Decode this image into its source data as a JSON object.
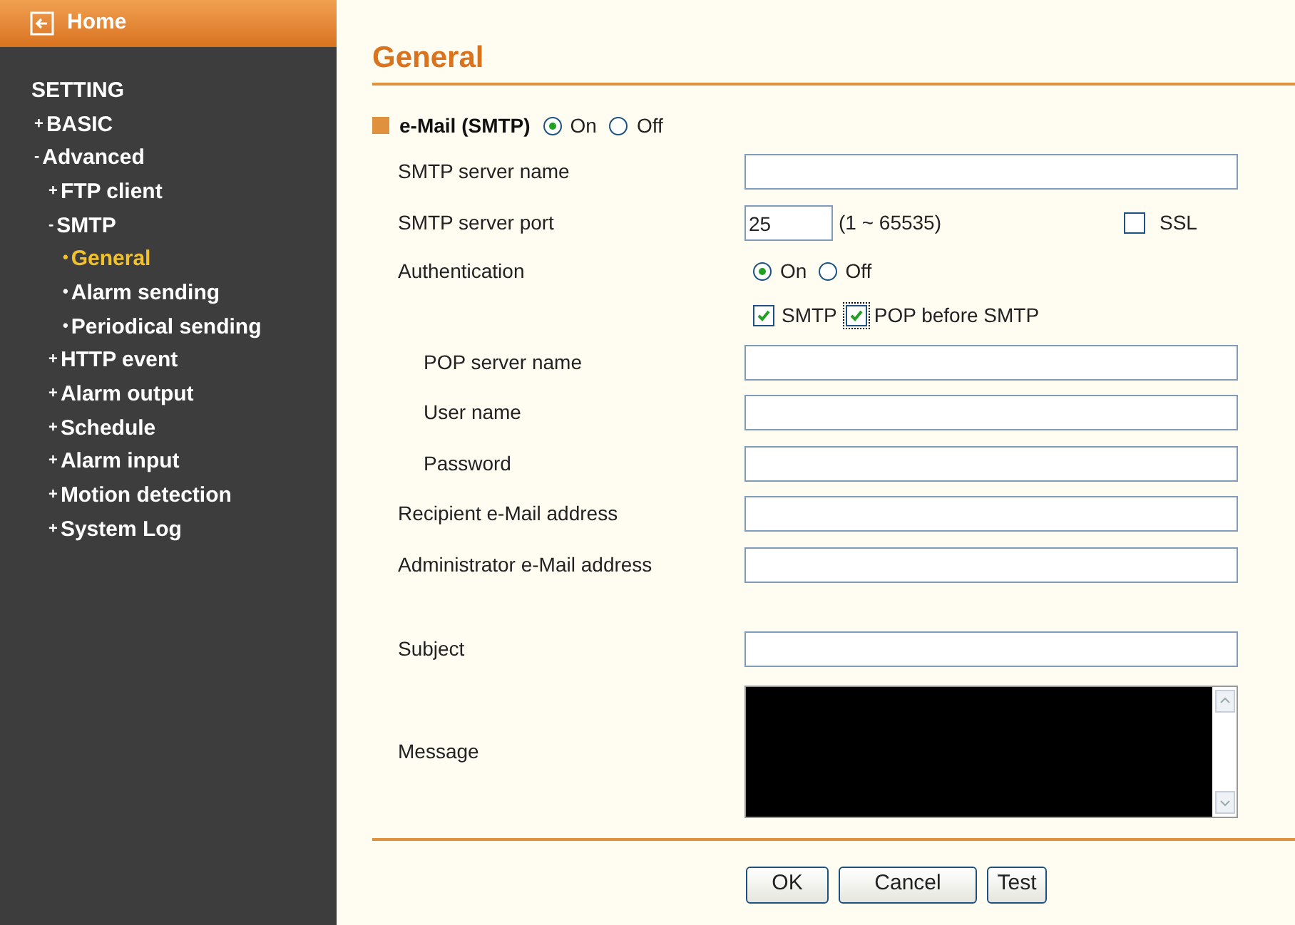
{
  "sidebar": {
    "home": "Home",
    "section": "SETTING",
    "items": [
      {
        "marker": "+",
        "label": "BASIC",
        "selected": false
      },
      {
        "marker": "-",
        "label": "Advanced",
        "selected": false,
        "children": [
          {
            "marker": "+",
            "label": "FTP client",
            "selected": false
          },
          {
            "marker": "-",
            "label": "SMTP",
            "selected": false,
            "children": [
              {
                "marker": "•",
                "label": "General",
                "selected": true
              },
              {
                "marker": "•",
                "label": "Alarm sending",
                "selected": false
              },
              {
                "marker": "•",
                "label": "Periodical sending",
                "selected": false
              }
            ]
          },
          {
            "marker": "+",
            "label": "HTTP event",
            "selected": false
          },
          {
            "marker": "+",
            "label": "Alarm output",
            "selected": false
          },
          {
            "marker": "+",
            "label": "Schedule",
            "selected": false
          },
          {
            "marker": "+",
            "label": "Alarm input",
            "selected": false
          },
          {
            "marker": "+",
            "label": "Motion detection",
            "selected": false
          },
          {
            "marker": "+",
            "label": "System Log",
            "selected": false
          }
        ]
      }
    ]
  },
  "page_title": "General",
  "email_toggle": {
    "label": "e-Mail (SMTP)",
    "options": [
      {
        "label": "On",
        "selected": true
      },
      {
        "label": "Off",
        "selected": false
      }
    ]
  },
  "rows": [
    {
      "kind": "text",
      "label": "SMTP server name",
      "indent": false
    },
    {
      "kind": "port",
      "label": "SMTP server port",
      "value": "25",
      "range": "(1 ~ 65535)",
      "ssl": {
        "label": "SSL",
        "checked": false
      }
    },
    {
      "kind": "radio",
      "label": "Authentication",
      "options": [
        {
          "label": "On",
          "selected": true
        },
        {
          "label": "Off",
          "selected": false
        }
      ]
    },
    {
      "kind": "checks",
      "options": [
        {
          "label": "SMTP",
          "checked": true
        },
        {
          "label": "POP before SMTP",
          "checked": true
        }
      ]
    },
    {
      "kind": "text",
      "label": "POP server name",
      "indent": true
    },
    {
      "kind": "text",
      "label": "User name",
      "indent": true
    },
    {
      "kind": "text",
      "label": "Password",
      "indent": true
    },
    {
      "kind": "text",
      "label": "Recipient e-Mail address",
      "indent": false
    },
    {
      "kind": "text",
      "label": "Administrator e-Mail address",
      "indent": false
    },
    {
      "kind": "spacer"
    },
    {
      "kind": "text",
      "label": "Subject",
      "indent": false
    },
    {
      "kind": "textarea",
      "label": "Message"
    }
  ],
  "buttons": [
    "OK",
    "Cancel",
    "Test"
  ]
}
